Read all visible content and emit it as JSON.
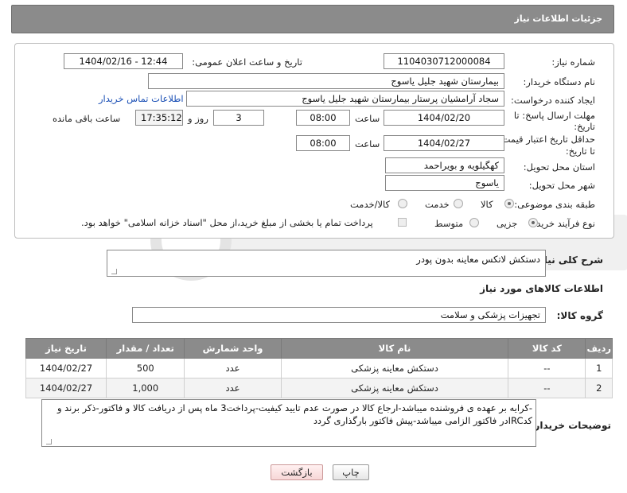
{
  "header": {
    "title": "جزئیات اطلاعات نیاز"
  },
  "form": {
    "need_number": {
      "label": "شماره نیاز:",
      "value": "1104030712000084"
    },
    "announce_datetime": {
      "label": "تاریخ و ساعت اعلان عمومی:",
      "value": "1404/02/16 - 12:44"
    },
    "buyer_org": {
      "label": "نام دستگاه خریدار:",
      "value": "بیمارستان شهید جلیل یاسوج"
    },
    "requester": {
      "label": "ایجاد کننده درخواست:",
      "value": "سجاد آرامشیان پرستار بیمارستان شهید جلیل یاسوج",
      "contact_link": "اطلاعات تماس خریدار"
    },
    "reply_deadline": {
      "label_line1": "مهلت ارسال پاسخ: تا",
      "label_line2": "تاریخ:",
      "date": "1404/02/20",
      "time_label": "ساعت",
      "time": "08:00",
      "days": "3",
      "days_label": "روز و",
      "remaining": "17:35:12",
      "remaining_label": "ساعت باقی مانده"
    },
    "price_validity": {
      "label_line1": "حداقل تاریخ اعتبار قیمت:",
      "label_line2": "تا تاریخ:",
      "date": "1404/02/27",
      "time_label": "ساعت",
      "time": "08:00"
    },
    "delivery_province": {
      "label": "استان محل تحویل:",
      "value": "کهگیلویه و بویراحمد"
    },
    "delivery_city": {
      "label": "شهر محل تحویل:",
      "value": "یاسوج"
    },
    "category": {
      "label": "طبقه بندی موضوعی:",
      "options": [
        "کالا",
        "خدمت",
        "کالا/خدمت"
      ],
      "selected": "کالا"
    },
    "process": {
      "label": "نوع فرآیند خرید :",
      "options": [
        "جزیی",
        "متوسط"
      ],
      "selected": "جزیی",
      "note": "پرداخت تمام یا بخشی از مبلغ خرید،از محل \"اسناد خزانه اسلامی\" خواهد بود."
    }
  },
  "description": {
    "label": "شرح کلی نیاز:",
    "value": "دستکش لاتکس معاینه بدون پودر"
  },
  "goods_section": {
    "title": "اطلاعات کالاهای مورد نیاز"
  },
  "goods_group": {
    "label": "گروه کالا:",
    "value": "تجهیزات پزشکی و سلامت"
  },
  "table": {
    "headers": [
      "ردیف",
      "کد کالا",
      "نام کالا",
      "واحد شمارش",
      "تعداد / مقدار",
      "تاریخ نیاز"
    ],
    "rows": [
      [
        "1",
        "--",
        "دستکش معاینه پزشکی",
        "عدد",
        "500",
        "1404/02/27"
      ],
      [
        "2",
        "--",
        "دستکش معاینه پزشکی",
        "عدد",
        "1,000",
        "1404/02/27"
      ]
    ]
  },
  "buyer_notes": {
    "label": "توضیحات خریدار:",
    "line1": "-کرایه بر عهده ی فروشنده میباشد-ارجاع کالا در صورت عدم تایید کیفیت-پرداخت3 ماه پس از دریافت کالا و فاکتور-ذکر برند و",
    "line2": "کدIRCدر فاکتور الزامی میباشد-پیش فاکتور بارگذاری گردد"
  },
  "buttons": {
    "print": "چاپ",
    "back": "بازگشت"
  },
  "colors": {
    "header_bg": "#8b8b8b",
    "link": "#1a4fb5"
  }
}
